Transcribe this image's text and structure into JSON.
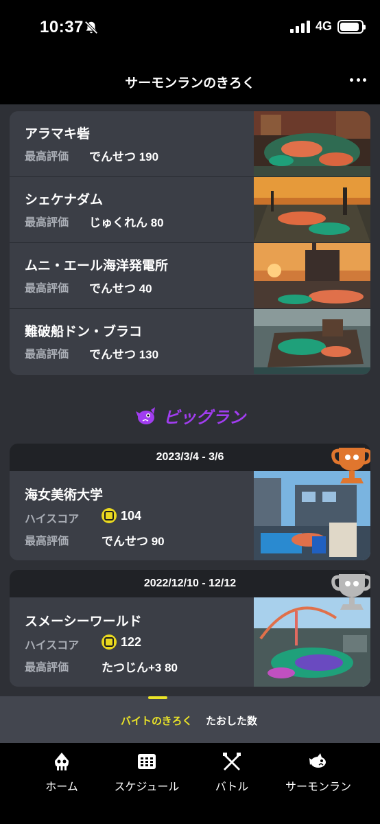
{
  "status": {
    "time": "10:37",
    "network": "4G",
    "battery_level": 0.9
  },
  "header": {
    "title": "サーモンランのきろく"
  },
  "stages": [
    {
      "name": "アラマキ砦",
      "grade_label": "最高評価",
      "grade": "でんせつ 190"
    },
    {
      "name": "シェケナダム",
      "grade_label": "最高評価",
      "grade": "じゅくれん 80"
    },
    {
      "name": "ムニ・エール海洋発電所",
      "grade_label": "最高評価",
      "grade": "でんせつ 40"
    },
    {
      "name": "難破船ドン・ブラコ",
      "grade_label": "最高評価",
      "grade": "でんせつ 130"
    }
  ],
  "big_run": {
    "title": "ビッグラン",
    "cards": [
      {
        "date": "2023/3/4 - 3/6",
        "stage": "海女美術大学",
        "score_label": "ハイスコア",
        "score": "104",
        "grade_label": "最高評価",
        "grade": "でんせつ 90",
        "trophy": "bronze-trophy-icon"
      },
      {
        "date": "2022/12/10 - 12/12",
        "stage": "スメーシーワールド",
        "score_label": "ハイスコア",
        "score": "122",
        "grade_label": "最高評価",
        "grade": "たつじん+3 80",
        "trophy": "silver-trophy-icon"
      }
    ]
  },
  "tabs": [
    {
      "label": "バイトのきろく",
      "active": true
    },
    {
      "label": "たおした数",
      "active": false
    }
  ],
  "bottom_nav": [
    {
      "label": "ホーム",
      "icon": "squid-icon"
    },
    {
      "label": "スケジュール",
      "icon": "calendar-icon"
    },
    {
      "label": "バトル",
      "icon": "crossed-weapons-icon"
    },
    {
      "label": "サーモンラン",
      "icon": "salmon-icon"
    }
  ],
  "colors": {
    "accent_yellow": "#ebe428",
    "big_run_purple": "#a13df0",
    "card_bg": "#3b3e46",
    "page_bg": "#2e3036",
    "bronze": "#e0762e",
    "silver": "#b8b8b8"
  }
}
